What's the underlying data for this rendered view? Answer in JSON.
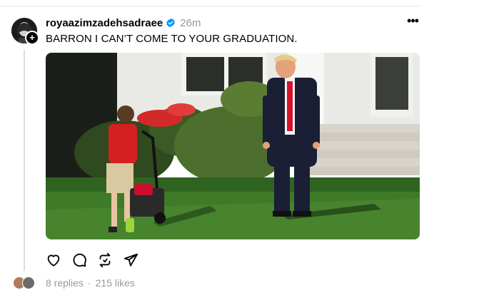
{
  "post": {
    "username": "royaazimzadehsadraee",
    "time": "26m",
    "text": "BARRON I CAN’T COME TO YOUR GRADUATION.",
    "more_label": "•••"
  },
  "footer": {
    "replies": "8 replies",
    "separator": "·",
    "likes": "215 likes"
  },
  "icons": {
    "verified": "verified-badge-icon",
    "like": "heart-icon",
    "reply": "comment-icon",
    "repost": "repost-icon",
    "share": "send-icon",
    "follow": "plus-icon"
  },
  "colors": {
    "verified": "#0095f6",
    "muted": "#999999",
    "divider": "#e5e5e5"
  }
}
